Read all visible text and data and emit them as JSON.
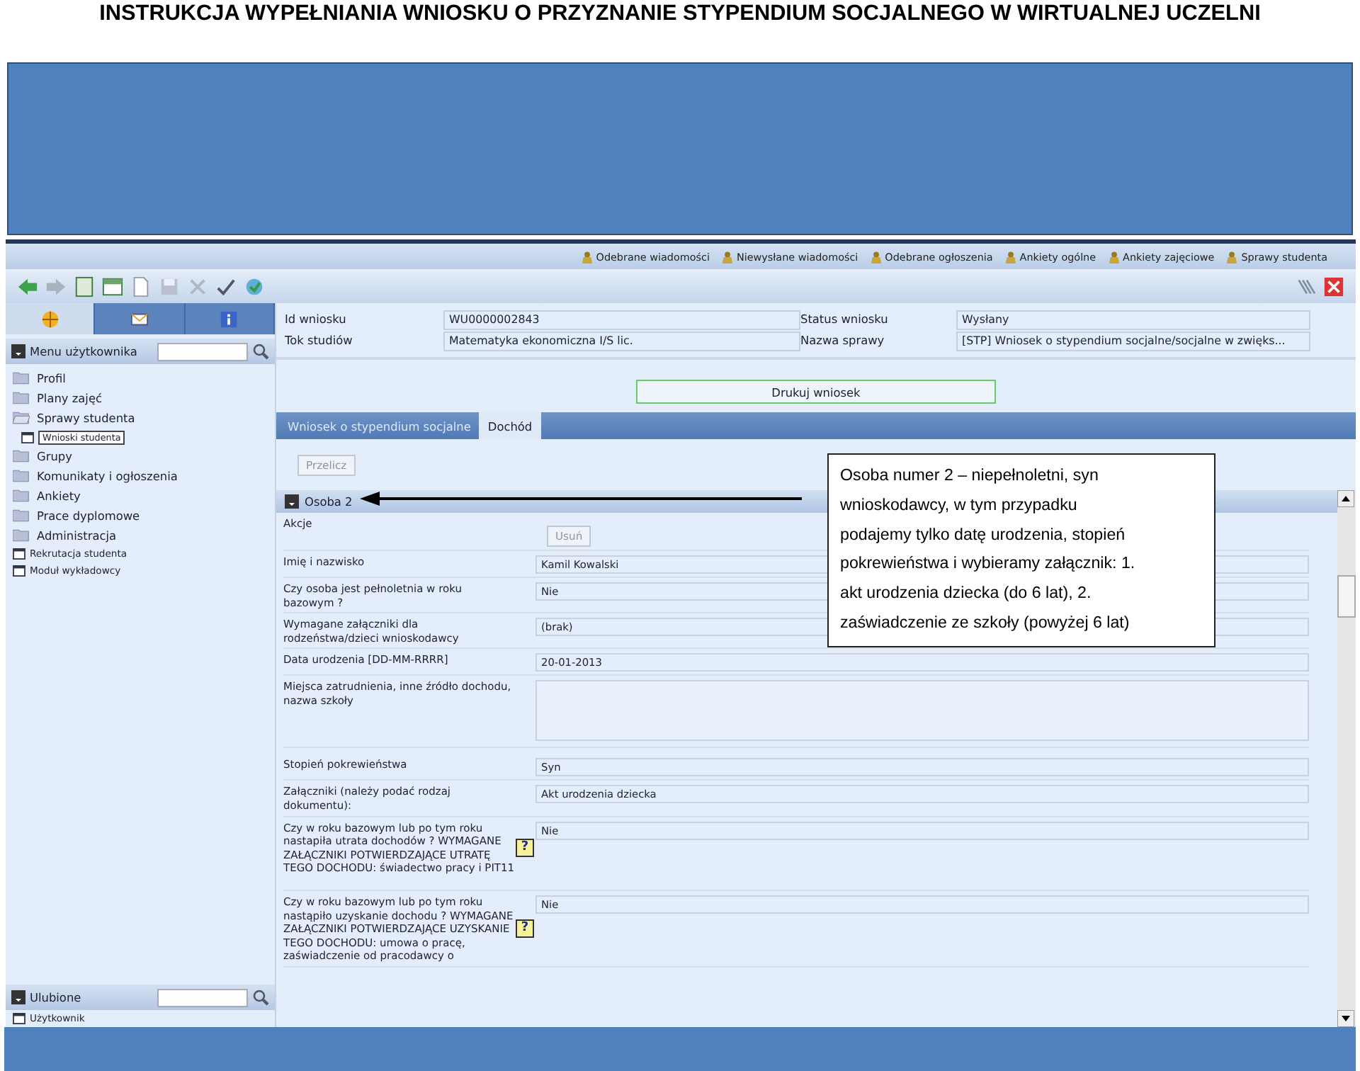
{
  "doc_title": "INSTRUKCJA WYPEŁNIANIA WNIOSKU O PRZYZNANIE STYPENDIUM SOCJALNEGO  W WIRTUALNEJ UCZELNI",
  "top_links": [
    {
      "label": "Odebrane wiadomości"
    },
    {
      "label": "Niewysłane wiadomości"
    },
    {
      "label": "Odebrane ogłoszenia"
    },
    {
      "label": "Ankiety ogólne"
    },
    {
      "label": "Ankiety zajęciowe"
    },
    {
      "label": "Sprawy studenta"
    }
  ],
  "sidebar": {
    "tabs": [
      {
        "kind": "compass",
        "selected": true
      },
      {
        "kind": "mail",
        "selected": false
      },
      {
        "kind": "info",
        "selected": false
      }
    ],
    "menu_title": "Menu użytkownika",
    "menu_items": [
      {
        "label": "Profil",
        "kind": "folder",
        "expanded": false,
        "selected": false
      },
      {
        "label": "Plany zajęć",
        "kind": "folder",
        "expanded": false,
        "selected": false
      },
      {
        "label": "Sprawy studenta",
        "kind": "folder",
        "expanded": true,
        "selected": false,
        "children": [
          {
            "label": "Wnioski studenta",
            "kind": "page",
            "selected": true
          }
        ]
      },
      {
        "label": "Grupy",
        "kind": "folder",
        "expanded": false,
        "selected": false
      },
      {
        "label": "Komunikaty i ogłoszenia",
        "kind": "folder",
        "expanded": false,
        "selected": false
      },
      {
        "label": "Ankiety",
        "kind": "folder",
        "expanded": false,
        "selected": false
      },
      {
        "label": "Prace dyplomowe",
        "kind": "folder",
        "expanded": false,
        "selected": false
      },
      {
        "label": "Administracja",
        "kind": "folder",
        "expanded": false,
        "selected": false
      },
      {
        "label": "Rekrutacja studenta",
        "kind": "page",
        "selected": false
      },
      {
        "label": "Moduł wykładowcy",
        "kind": "page",
        "selected": false
      }
    ],
    "favorites_title": "Ulubione",
    "favorites": [
      {
        "label": "Użytkownik"
      }
    ]
  },
  "header_fields": [
    {
      "label": "Id wniosku",
      "value": "WU0000002843"
    },
    {
      "label": "Status wniosku",
      "value": "Wysłany"
    },
    {
      "label": "Tok studiów",
      "value": "Matematyka ekonomiczna I/S lic."
    },
    {
      "label": "Nazwa sprawy",
      "value": "[STP] Wniosek o stypendium socjalne/socjalne w zwięks..."
    }
  ],
  "print_button": "Drukuj wniosek",
  "tabs": [
    {
      "label": "Wniosek o stypendium socjalne",
      "selected": false
    },
    {
      "label": "Dochód",
      "selected": true
    }
  ],
  "recalc_button": {
    "label": "Przelicz",
    "disabled": true
  },
  "section": {
    "title": "Osoba 2",
    "expanded": true
  },
  "form_rows": [
    {
      "label": "Akcje",
      "kind": "button",
      "value": "Usuń"
    },
    {
      "label": "Imię i nazwisko",
      "kind": "field",
      "value": "Kamil Kowalski"
    },
    {
      "label": "Czy osoba jest pełnoletnia w roku bazowym ?",
      "kind": "field",
      "value": "Nie"
    },
    {
      "label": "Wymagane załączniki dla rodzeństwa/dzieci wnioskodawcy",
      "kind": "field",
      "value": "(brak)"
    },
    {
      "label": "Data urodzenia [DD-MM-RRRR]",
      "kind": "field",
      "value": "20-01-2013"
    },
    {
      "label": "Miejsca zatrudnienia, inne źródło dochodu, nazwa szkoły",
      "kind": "textarea"
    },
    {
      "label": "Stopień pokrewieństwa",
      "kind": "field",
      "value": "Syn"
    },
    {
      "label": "Załączniki (należy podać rodzaj dokumentu):",
      "kind": "field",
      "value": "Akt urodzenia dziecka"
    },
    {
      "label": "Czy w roku bazowym lub po tym roku nastapiła utrata dochodów ? WYMAGANE ZAŁĄCZNIKI POTWIERDZAJĄCE UTRATĘ TEGO DOCHODU: świadectwo pracy i PIT11",
      "kind": "field",
      "value": "Nie",
      "help": "?"
    },
    {
      "label": "Czy w roku bazowym lub po tym roku nastąpiło uzyskanie dochodu ? WYMAGANE ZAŁĄCZNIKI POTWIERDZAJĄCE UZYSKANIE TEGO DOCHODU: umowa o pracę, zaświadczenie od pracodawcy o",
      "kind": "field",
      "value": "Nie",
      "help": "?"
    }
  ],
  "callout": "Osoba numer 2 – niepełnoletni, syn\nwnioskodawcy, w tym przypadku\npodajemy tylko datę urodzenia, stopień\npokrewieństwa i wybieramy załącznik: 1.\nakt urodzenia dziecka (do 6 lat), 2.\nzaświadczenie ze szkoły (powyżej 6 lat)"
}
